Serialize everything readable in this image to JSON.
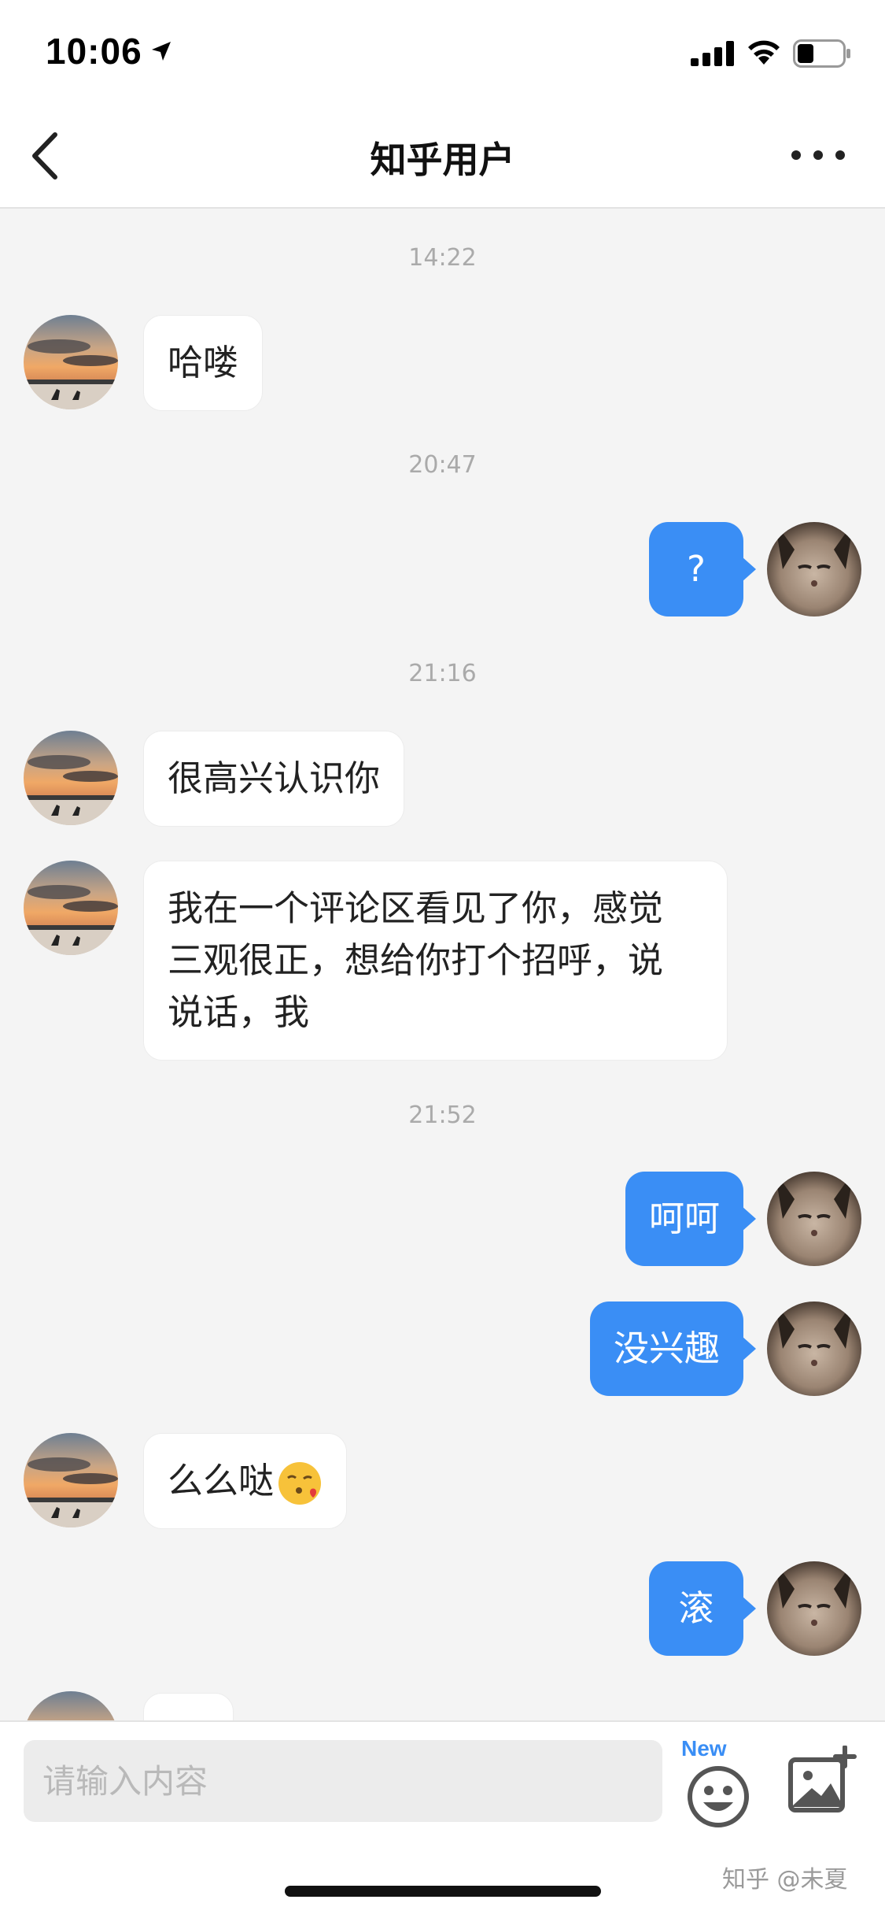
{
  "status_bar": {
    "time": "10:06"
  },
  "nav": {
    "title": "知乎用户"
  },
  "messages": [
    {
      "type": "timestamp",
      "text": "14:22"
    },
    {
      "type": "incoming",
      "text": "哈喽"
    },
    {
      "type": "timestamp",
      "text": "20:47"
    },
    {
      "type": "outgoing",
      "text": "?"
    },
    {
      "type": "timestamp",
      "text": "21:16"
    },
    {
      "type": "incoming",
      "text": "很高兴认识你"
    },
    {
      "type": "incoming",
      "lines": [
        "我在一个评论区看见了你，感觉",
        "三观很正，想给你打个招呼，说",
        "说话，我"
      ]
    },
    {
      "type": "timestamp",
      "text": "21:52"
    },
    {
      "type": "outgoing",
      "text": "呵呵"
    },
    {
      "type": "outgoing",
      "text": "没兴趣"
    },
    {
      "type": "incoming",
      "text": "么么哒",
      "emoji": "kissing-face-emoji"
    },
    {
      "type": "outgoing",
      "text": "滚"
    }
  ],
  "input": {
    "placeholder": "请输入内容"
  },
  "emoji_button": {
    "badge": "New",
    "icon": "smiley-face-icon"
  },
  "image_button": {
    "icon": "add-image-icon"
  },
  "watermark": "知乎 @未夏",
  "colors": {
    "accent": "#3a8ef5",
    "background": "#f4f4f4",
    "bubble_incoming": "#ffffff",
    "timestamp": "#aaaaaa"
  }
}
